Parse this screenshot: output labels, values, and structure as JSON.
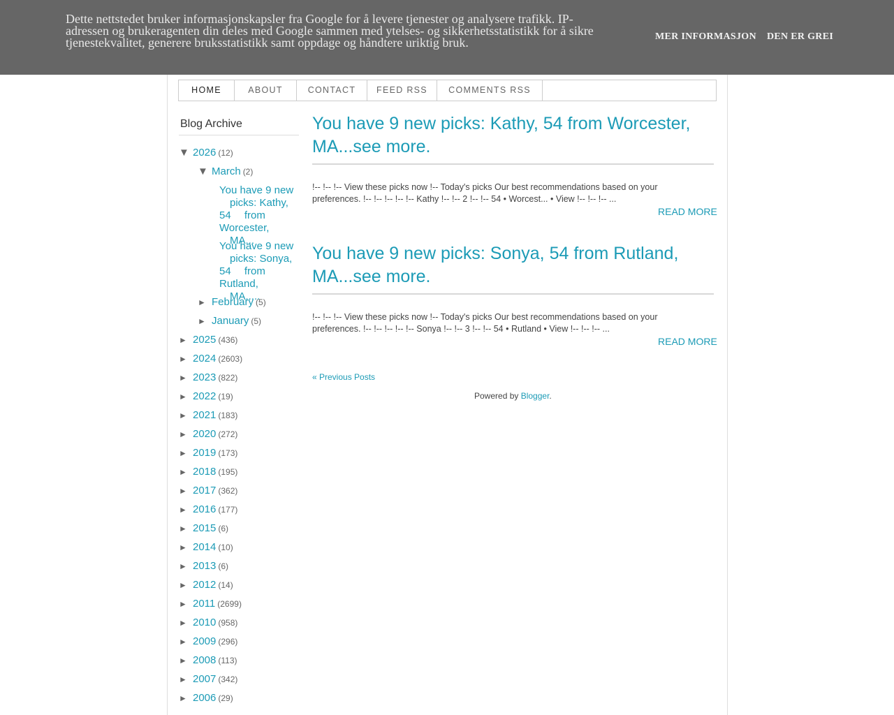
{
  "cookie": {
    "text": "Dette nettstedet bruker informasjonskapsler fra Google for å levere tjenester og analysere trafikk. IP-adressen og brukeragenten din deles med Google sammen med ytelses- og sikkerhetsstatistikk for å sikre tjenestekvalitet, generere bruksstatistikk samt oppdage og håndtere uriktig bruk.",
    "more_label": "MER INFORMASJON",
    "ok_label": "DEN ER GREI"
  },
  "tabs": [
    "HOME",
    "ABOUT",
    "CONTACT",
    "FEED RSS",
    "COMMENTS RSS"
  ],
  "sidebar": {
    "title": "Blog Archive",
    "expanded_year": {
      "year": "2026",
      "count": "(12)",
      "toggle": "▼"
    },
    "expanded_month": {
      "month": "March",
      "count": "(2)",
      "toggle": "▼"
    },
    "march_posts": [
      [
        "You have 9 new",
        "picks: Kathy, 54",
        "from Worcester,",
        "MA..."
      ],
      [
        "You have 9 new",
        "picks: Sonya, 54",
        "from Rutland,",
        "MA....."
      ]
    ],
    "other_months": [
      {
        "month": "February",
        "count": "(5)",
        "toggle": "►"
      },
      {
        "month": "January",
        "count": "(5)",
        "toggle": "►"
      }
    ],
    "years": [
      {
        "year": "2025",
        "count": "(436)"
      },
      {
        "year": "2024",
        "count": "(2603)"
      },
      {
        "year": "2023",
        "count": "(822)"
      },
      {
        "year": "2022",
        "count": "(19)"
      },
      {
        "year": "2021",
        "count": "(183)"
      },
      {
        "year": "2020",
        "count": "(272)"
      },
      {
        "year": "2019",
        "count": "(173)"
      },
      {
        "year": "2018",
        "count": "(195)"
      },
      {
        "year": "2017",
        "count": "(362)"
      },
      {
        "year": "2016",
        "count": "(177)"
      },
      {
        "year": "2015",
        "count": "(6)"
      },
      {
        "year": "2014",
        "count": "(10)"
      },
      {
        "year": "2013",
        "count": "(6)"
      },
      {
        "year": "2012",
        "count": "(14)"
      },
      {
        "year": "2011",
        "count": "(2699)"
      },
      {
        "year": "2010",
        "count": "(958)"
      },
      {
        "year": "2009",
        "count": "(296)"
      },
      {
        "year": "2008",
        "count": "(113)"
      },
      {
        "year": "2007",
        "count": "(342)"
      },
      {
        "year": "2006",
        "count": "(29)"
      }
    ],
    "collapsed_toggle": "►"
  },
  "posts": [
    {
      "title_lines": [
        "You have 9 new picks: Kathy, 54 from Worcester,",
        "MA...see more."
      ],
      "snippet_lines": [
        "!-- !-- !-- View these picks now !-- Today's picks Our best recommendations based on your",
        "preferences. !-- !-- !-- !-- !-- Kathy !-- !-- 2  !-- !-- 54 • Worcest... • View !-- !-- !-- ..."
      ],
      "read_more": "READ MORE"
    },
    {
      "title_lines": [
        "You have 9 new picks: Sonya, 54 from Rutland,",
        "MA...see more."
      ],
      "snippet_lines": [
        "!-- !-- !-- View these picks now !-- Today's picks Our best recommendations based on your",
        "preferences. !-- !-- !-- !-- !-- Sonya !-- !-- 3  !-- !-- 54 • Rutland • View !-- !-- !-- ..."
      ],
      "read_more": "READ MORE"
    }
  ],
  "footer": {
    "previous_posts": "« Previous Posts",
    "powered_prefix": "Powered by ",
    "powered_link": "Blogger",
    "powered_suffix": "."
  },
  "colors": {
    "link": "#1c9bb6",
    "banner": "#666666"
  }
}
